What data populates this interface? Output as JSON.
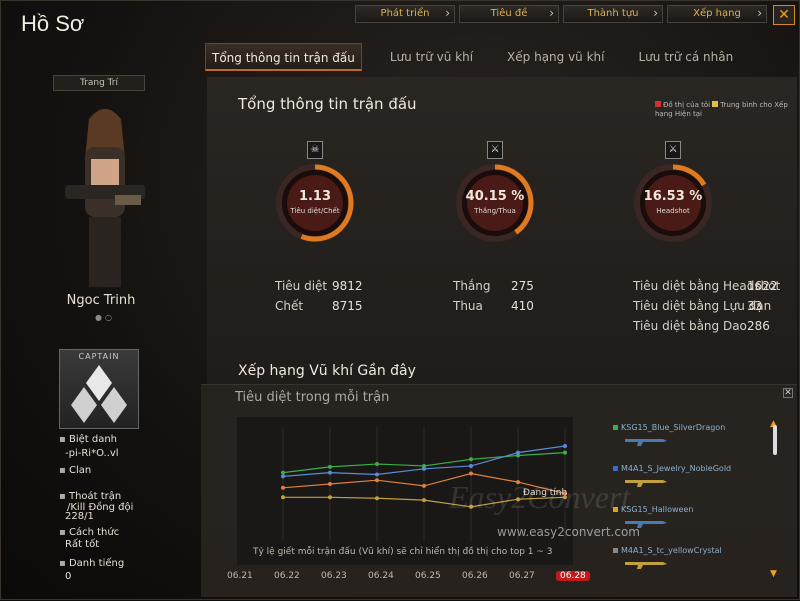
{
  "title": "Hồ Sơ",
  "top_nav": [
    "Phát triển",
    "Tiêu đề",
    "Thành tựu",
    "Xếp hạng"
  ],
  "close_label": "✕",
  "tabs": [
    "Tổng thông tin trận đấu",
    "Lưu trữ vũ khí",
    "Xếp hạng vũ khí",
    "Lưu trữ cá nhân"
  ],
  "left": {
    "decor_button": "Trang Trí",
    "char_name": "Ngoc Trinh",
    "badge_text": "CAPTAIN",
    "alias_label": "Biệt danh",
    "alias_value": "-pi-Ri*O..vl",
    "clan_label": "Clan",
    "quit_label": "Thoát trận",
    "teamkill_label": "/Kill Đồng đội",
    "quit_value": "228/1",
    "style_label": "Cách thức",
    "style_value": "Rất tốt",
    "fame_label": "Danh tiếng",
    "fame_value": "0"
  },
  "overview": {
    "title": "Tổng thông tin trận đấu",
    "legend_mine": "Đồ thị của tôi",
    "legend_avg": "Trung bình cho Xếp hạng Hiện tại",
    "legend_mine_color": "#d03030",
    "legend_avg_color": "#e0c040",
    "gauges": [
      {
        "value": "1.13",
        "label": "Tiêu diệt/Chết",
        "icon": "skull-icon",
        "glyph": "☠",
        "fill": 0.56
      },
      {
        "value": "40.15",
        "unit": "%",
        "label": "Thắng/Thua",
        "icon": "crossed-swords-icon",
        "glyph": "⚔",
        "fill": 0.4015
      },
      {
        "value": "16.53",
        "unit": "%",
        "label": "Headshot",
        "icon": "knife-icon",
        "glyph": "⚔",
        "fill": 0.1653
      }
    ],
    "stats": {
      "kills_label": "Tiêu diệt",
      "kills_value": "9812",
      "deaths_label": "Chết",
      "deaths_value": "8715",
      "wins_label": "Thắng",
      "wins_value": "275",
      "losses_label": "Thua",
      "losses_value": "410",
      "hs_label": "Tiêu diệt bằng Headshot",
      "hs_value": "1622",
      "gren_label": "Tiêu diệt bằng Lựu đạn",
      "gren_value": "33",
      "knife_label": "Tiêu diệt bằng Dao",
      "knife_value": "286"
    }
  },
  "recent": {
    "title": "Xếp hạng Vũ khí Gần đây",
    "panel_title": "Tiêu diệt trong mỗi trận",
    "rank_label": "Đang tính",
    "note": "Tỷ lệ giết mỗi trận đấu (Vũ khí) sẽ chỉ hiển thị đồ thị cho top 1 ~ 3",
    "weapons": [
      {
        "name": "KSG15_Blue_SilverDragon",
        "color": "#3ab04a"
      },
      {
        "name": "M4A1_S_Jewelry_NobleGold",
        "color": "#3a6ad0"
      },
      {
        "name": "KSG15_Halloween",
        "color": "#e0a020"
      },
      {
        "name": "M4A1_S_tc_yellowCrystal",
        "color": "#888888"
      }
    ]
  },
  "chart_data": {
    "type": "line",
    "x": [
      "06.21",
      "06.22",
      "06.23",
      "06.24",
      "06.25",
      "06.26",
      "06.27",
      "06.28"
    ],
    "active_x": "06.28",
    "series": [
      {
        "name": "KSG15_Blue_SilverDragon",
        "color": "#3ab04a",
        "values": [
          7.2,
          7.8,
          8.1,
          7.9,
          8.6,
          9.0,
          9.3
        ]
      },
      {
        "name": "M4A1_S_Jewelry_NobleGold",
        "color": "#5a8ad8",
        "values": [
          6.8,
          7.2,
          7.0,
          7.6,
          7.9,
          9.3,
          10.0
        ]
      },
      {
        "name": "KSG15_Halloween",
        "color": "#e08040",
        "values": [
          5.6,
          6.0,
          6.4,
          5.8,
          7.1,
          6.2,
          5.0
        ]
      },
      {
        "name": "M4A1_S_tc_yellowCrystal",
        "color": "#c0a040",
        "values": [
          4.6,
          4.6,
          4.5,
          4.3,
          3.6,
          4.4,
          4.6
        ]
      }
    ],
    "ylim": [
      0,
      12
    ],
    "grid": true
  },
  "watermark": "Easy2Convert",
  "watermark_url": "www.easy2convert.com"
}
